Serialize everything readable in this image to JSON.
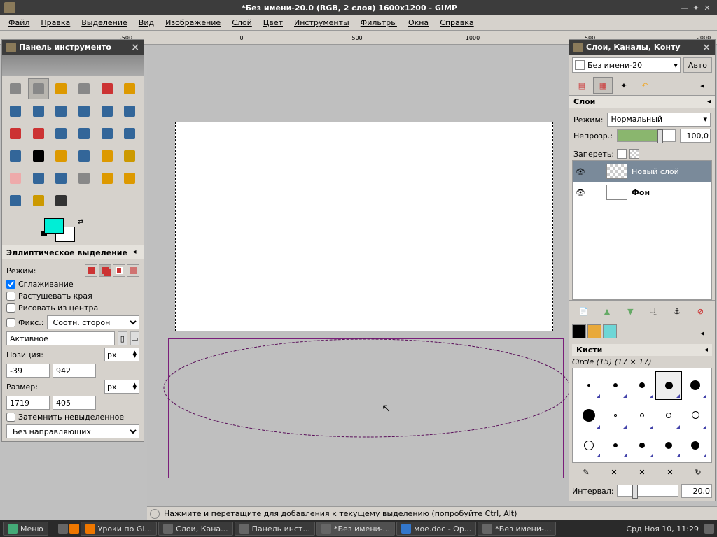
{
  "window": {
    "title": "*Без имени-20.0 (RGB, 2 слоя) 1600x1200 - GIMP"
  },
  "menu": [
    "Файл",
    "Правка",
    "Выделение",
    "Вид",
    "Изображение",
    "Слой",
    "Цвет",
    "Инструменты",
    "Фильтры",
    "Окна",
    "Справка"
  ],
  "ruler_ticks": [
    "-500",
    "0",
    "500",
    "1000",
    "1500",
    "2000"
  ],
  "toolbox": {
    "title": "Панель инструменто",
    "tools": [
      "rect-select",
      "ellipse-select",
      "free-select",
      "fuzzy-select",
      "by-color-select",
      "scissors",
      "foreground-select",
      "paths",
      "color-picker",
      "zoom",
      "measure",
      "move",
      "align",
      "crop",
      "rotate",
      "scale",
      "shear",
      "perspective",
      "flip",
      "text",
      "bucket-fill",
      "blend",
      "pencil",
      "paintbrush",
      "eraser",
      "airbrush",
      "ink",
      "clone",
      "heal",
      "perspective-clone",
      "blur",
      "dodge",
      "smudge"
    ],
    "colors": {
      "fg": "#00eed6",
      "bg": "#ffffff"
    }
  },
  "tool_options": {
    "title": "Эллиптическое выделение",
    "mode_label": "Режим:",
    "antialias": "Сглаживание",
    "feather": "Растушевать края",
    "from_center": "Рисовать из центра",
    "fixed_label": "Фикс.:",
    "fixed_combo": "Соотн. сторон",
    "active_value": "Активное",
    "position_label": "Позиция:",
    "pos_x": "-39",
    "pos_y": "942",
    "unit": "px",
    "size_label": "Размер:",
    "size_w": "1719",
    "size_h": "405",
    "highlight": "Затемнить невыделенное",
    "guides": "Без направляющих"
  },
  "status": "Нажмите и перетащите для добавления к текущему выделению (попробуйте Ctrl, Alt)",
  "layers_dock": {
    "title": "Слои, Каналы, Конту",
    "image": "Без имени-20",
    "auto": "Авто",
    "section": "Слои",
    "mode_label": "Режим:",
    "mode_value": "Нормальный",
    "opacity_label": "Непрозр.:",
    "opacity_value": "100,0",
    "lock_label": "Запереть:",
    "layers": [
      {
        "name": "Новый слой",
        "trans": true,
        "sel": true
      },
      {
        "name": "Фон",
        "trans": false,
        "sel": false
      }
    ]
  },
  "brushes": {
    "section": "Кисти",
    "subtitle": "Circle (15) (17 × 17)",
    "interval_label": "Интервал:",
    "interval_value": "20,0",
    "sizes": [
      4,
      6,
      8,
      11,
      14,
      18,
      4,
      6,
      8,
      11,
      14,
      6,
      8,
      10,
      12
    ]
  },
  "taskbar": {
    "menu": "Меню",
    "items": [
      "Уроки по GI...",
      "Слои, Кана...",
      "Панель инст...",
      "*Без имени-...",
      "мoe.doc - Op...",
      "*Без имени-..."
    ],
    "clock": "Срд Ноя 10, 11:29"
  }
}
